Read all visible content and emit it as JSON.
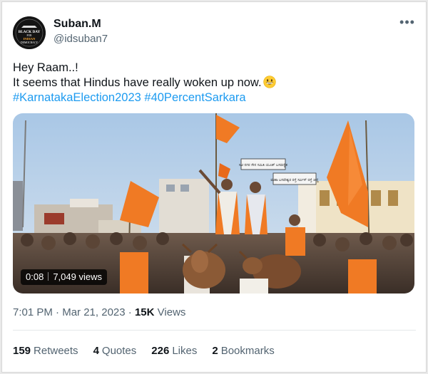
{
  "author": {
    "name": "Suban.M",
    "handle": "@idsuban7",
    "avatar_text": [
      "BLACK DAY",
      "FOR",
      "INDIAN",
      "DEMOCRACY"
    ]
  },
  "tweet": {
    "line1": "Hey Raam..!",
    "line2": "It seems that Hindus have really woken up now.",
    "emoji": "grinning-face-emoji",
    "hashtag1": "#KarnatakaElection2023",
    "hashtag2": "#40PercentSarkara"
  },
  "video": {
    "duration": "0:08",
    "views": "7,049 views",
    "sign1": "ಸಿಟಿ ನಗರ ಸೇನ ಸಮಿತಿ ಯೂತ್ ಬಸವಣ್ಣಿತ",
    "sign2": "ಮಹಾ ಬಸವೇಶ್ವರ ರಸ್ತೆ ಸರ್ವಿಸ್ ರಸ್ತೆ ಚಿಣ್ಣಿ"
  },
  "meta": {
    "time": "7:01 PM",
    "sep": "·",
    "date": "Mar 21, 2023",
    "views_count": "15K",
    "views_label": "Views"
  },
  "stats": [
    {
      "count": "159",
      "label": "Retweets"
    },
    {
      "count": "4",
      "label": "Quotes"
    },
    {
      "count": "226",
      "label": "Likes"
    },
    {
      "count": "2",
      "label": "Bookmarks"
    }
  ],
  "colors": {
    "link": "#1d9bf0",
    "secondary_text": "#536471",
    "primary_text": "#0f1419",
    "saffron": "#f07a24"
  }
}
